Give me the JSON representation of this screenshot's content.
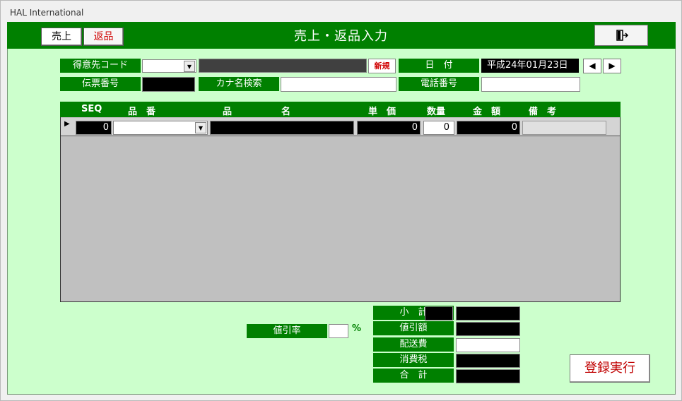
{
  "window": {
    "title": "HAL International"
  },
  "header": {
    "title": "売上・返品入力",
    "sales_tab": "売上",
    "return_tab": "返品",
    "exit_icon": "exit-door-icon"
  },
  "form": {
    "customer_code_label": "得意先コード",
    "customer_code_value": "",
    "new_button": "新規",
    "date_label": "日　付",
    "date_value": "平成24年01月23日",
    "prev_icon": "◀",
    "next_icon": "▶",
    "slip_no_label": "伝票番号",
    "kana_search_label": "カナ名検索",
    "kana_search_value": "",
    "phone_label": "電話番号",
    "phone_value": ""
  },
  "grid": {
    "columns": [
      "SEQ",
      "品　番",
      "品",
      "名",
      "単　価",
      "数量",
      "金　額",
      "備　考"
    ],
    "rows": [
      {
        "seq": "0",
        "item_code": "",
        "item_name": "",
        "unit_price": "0",
        "qty": "0",
        "amount": "0",
        "note": ""
      }
    ]
  },
  "totals": {
    "discount_rate_label": "値引率",
    "discount_rate_value": "",
    "percent": "%",
    "subtotal_label": "小　計",
    "discount_amount_label": "値引額",
    "shipping_label": "配送費",
    "tax_label": "消費税",
    "total_label": "合　計",
    "register_button": "登録実行"
  },
  "colors": {
    "header_green": "#008000",
    "form_bg": "#ccffcc",
    "accent_red": "#d00000"
  }
}
